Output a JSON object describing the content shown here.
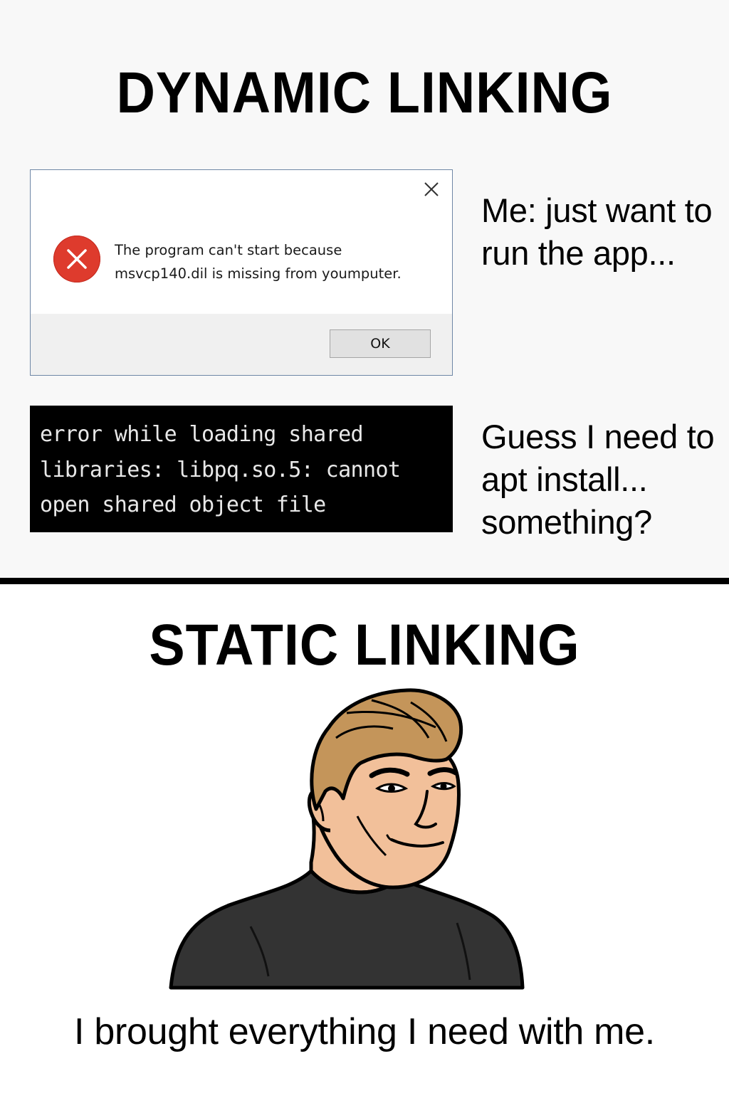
{
  "dynamic_section": {
    "title": "DYNAMIC LINKING",
    "dialog": {
      "message_line1": "The program can't start because",
      "message_line2": "msvcp140.dil is missing from youmputer.",
      "ok_label": "OK",
      "close_icon": "close-icon",
      "status_icon": "error-icon"
    },
    "caption_1": "Me: just want to run the app...",
    "terminal": {
      "line1": "error while loading shared",
      "line2": "libraries: libpq.so.5: cannot",
      "line3": "open shared object file"
    },
    "caption_2": "Guess I need to apt install... something?"
  },
  "static_section": {
    "title": "STATIC LINKING",
    "character_icon": "confident-man-illustration",
    "caption": "I brought everything I need with me."
  },
  "colors": {
    "error_red": "#de3b2d",
    "terminal_bg": "#000000",
    "hair": "#c4955a",
    "skin": "#f2c09a",
    "shirt": "#333333"
  }
}
